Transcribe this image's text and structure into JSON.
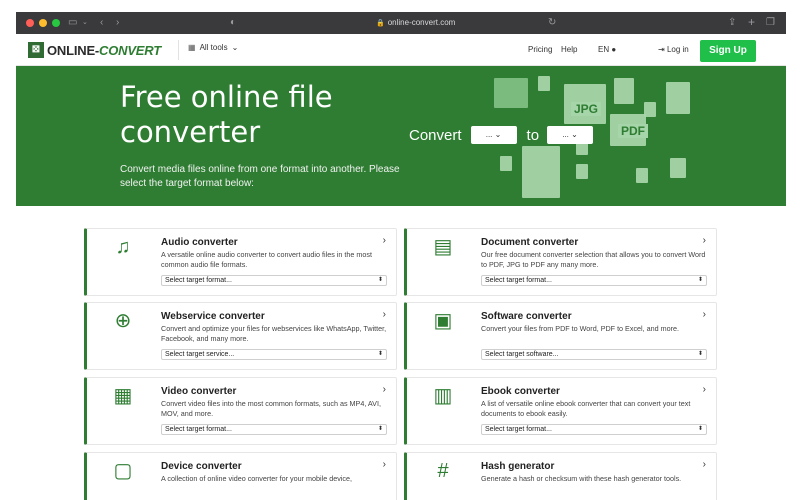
{
  "browser": {
    "url": "online-convert.com"
  },
  "nav": {
    "logo_mark": "⊠",
    "logo_text_a": "ONLINE-",
    "logo_text_b": "CONVERT",
    "all_tools": "All tools",
    "links": [
      "Pricing",
      "Help"
    ],
    "language": "EN",
    "login": "Log in",
    "signup": "Sign Up"
  },
  "hero": {
    "title": "Free online file converter",
    "subtitle": "Convert media files online from one format into another. Please select the target format below:",
    "convert_label": "Convert",
    "from_value": "...",
    "to_label": "to",
    "to_value": "...",
    "file_labels": [
      "JPG",
      "PDF"
    ]
  },
  "colors": {
    "brand_green": "#2e7d32",
    "signup_green": "#1fbf4a"
  },
  "cards": [
    {
      "title": "Audio converter",
      "icon": "music-note-icon",
      "glyph": "♫",
      "description": "A versatile online audio converter to convert audio files in the most common audio file formats.",
      "select": "Select target format..."
    },
    {
      "title": "Document converter",
      "icon": "document-icon",
      "glyph": "▤",
      "description": "Our free document converter selection that allows you to convert Word to PDF, JPG to PDF any many more.",
      "select": "Select target format..."
    },
    {
      "title": "Webservice converter",
      "icon": "globe-icon",
      "glyph": "⊕",
      "description": "Convert and optimize your files for webservices like WhatsApp, Twitter, Facebook, and many more.",
      "select": "Select target service..."
    },
    {
      "title": "Software converter",
      "icon": "monitor-icon",
      "glyph": "▣",
      "description": "Convert your files from PDF to Word, PDF to Excel, and more.",
      "select": "Select target software..."
    },
    {
      "title": "Video converter",
      "icon": "film-icon",
      "glyph": "▦",
      "description": "Convert video files into the most common formats, such as MP4, AVI, MOV, and more.",
      "select": "Select target format..."
    },
    {
      "title": "Ebook converter",
      "icon": "books-icon",
      "glyph": "▥",
      "description": "A list of versatile online ebook converter that can convert your text documents to ebook easily.",
      "select": "Select target format..."
    },
    {
      "title": "Device converter",
      "icon": "tablet-icon",
      "glyph": "▢",
      "description": "A collection of online video converter for your mobile device,",
      "select": ""
    },
    {
      "title": "Hash generator",
      "icon": "hash-icon",
      "glyph": "#",
      "description": "Generate a hash or checksum with these hash generator tools.",
      "select": ""
    }
  ]
}
